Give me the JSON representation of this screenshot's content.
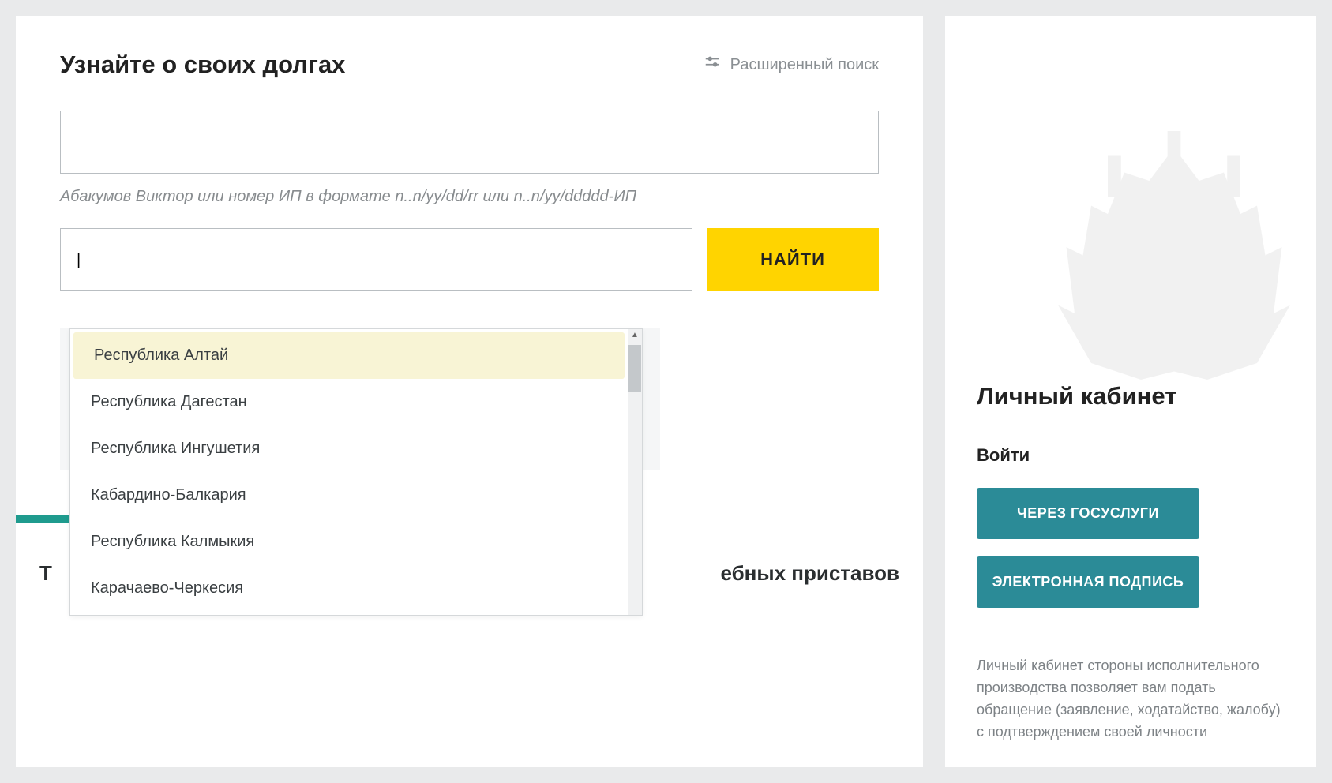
{
  "main": {
    "title": "Узнайте о своих долгах",
    "advanced_search": "Расширенный поиск",
    "hint": "Абакумов Виктор или номер ИП в формате n..n/yy/dd/rr или n..n/yy/ddddd-ИП",
    "search_button": "НАЙТИ",
    "region_value": "|"
  },
  "dropdown": {
    "items": [
      "Республика Алтай",
      "Республика Дагестан",
      "Республика Ингушетия",
      "Кабардино-Балкария",
      "Республика Калмыкия",
      "Карачаево-Черкесия"
    ],
    "selected_index": 0
  },
  "sidebar": {
    "title": "Личный кабинет",
    "login_label": "Войти",
    "gosuslugi_button": "ЧЕРЕЗ ГОСУСЛУГИ",
    "signature_button": "ЭЛЕКТРОННАЯ ПОДПИСЬ",
    "description": "Личный кабинет стороны исполнительного производства позволяет вам подать обращение (заявление, ходатайство, жалобу) с подтверждением своей личности"
  },
  "bottom": {
    "left_fragment": "Т",
    "right_fragment": "ебных приставов"
  },
  "colors": {
    "accent_teal": "#2b8b97",
    "accent_yellow": "#ffd400",
    "tab_green": "#1f9b8e"
  }
}
